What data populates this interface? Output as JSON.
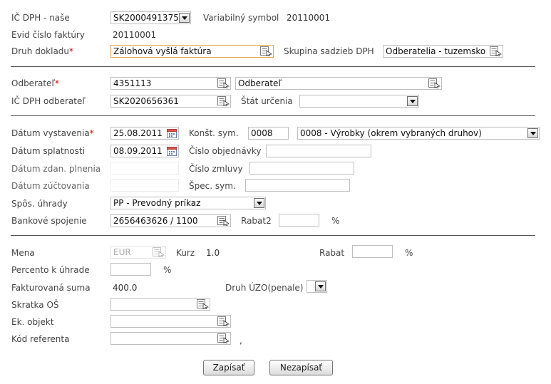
{
  "row1": {
    "ic_dph_nase_label": "IČ DPH - naše",
    "ic_dph_nase_value": "SK2000491375",
    "variabilny_symbol_label": "Variabilný symbol",
    "variabilny_symbol_value": "20110001"
  },
  "row2": {
    "evid_cislo_label": "Evid číslo faktúry",
    "evid_cislo_value": "20110001"
  },
  "row3": {
    "druh_dokladu_label": "Druh dokladu",
    "required_mark": "*",
    "druh_dokladu_value": "Zálohová vyšlá faktúra",
    "skupina_label": "Skupina sadzieb DPH",
    "skupina_value": "Odberatelia - tuzemsko"
  },
  "customer": {
    "odberatel_label": "Odberateľ",
    "required_mark": "*",
    "odberatel_code": "4351113",
    "odberatel_name": "Odberateľ",
    "ic_dph_odberatel_label": "IČ DPH odberateľ",
    "ic_dph_odberatel_value": "SK2020656361",
    "stat_urcenia_label": "Štát určenia",
    "stat_urcenia_value": ""
  },
  "dates": {
    "datum_vystavenia_label": "Dátum vystavenia",
    "required_mark": "*",
    "datum_vystavenia_value": "25.08.2011",
    "konst_sym_label": "Konšt. sym.",
    "konst_sym_code": "0008",
    "konst_sym_desc": "0008 - Výrobky (okrem vybraných druhov)",
    "datum_splatnosti_label": "Dátum splatnosti",
    "datum_splatnosti_value": "08.09.2011",
    "cislo_objednavky_label": "Číslo objednávky",
    "cislo_objednavky_value": "",
    "datum_zdan_label": "Dátum zdan. plnenia",
    "datum_zdan_value": "",
    "cislo_zmluvy_label": "Číslo zmluvy",
    "cislo_zmluvy_value": "",
    "datum_zuct_label": "Dátum zúčtovania",
    "datum_zuct_value": "",
    "spec_sym_label": "Špec. sym.",
    "spec_sym_value": "",
    "sposob_uhrady_label": "Spôs. úhrady",
    "sposob_uhrady_value": "PP - Prevodný príkaz",
    "bankove_spojenie_label": "Bankové spojenie",
    "bankove_spojenie_value": "2656463626 / 1100",
    "rabat2_label": "Rabat2",
    "rabat2_value": "",
    "percent_sign": "%"
  },
  "finance": {
    "mena_label": "Mena",
    "mena_value": "EUR",
    "kurz_label": "Kurz",
    "kurz_value": "1.0",
    "rabat_label": "Rabat",
    "rabat_value": "",
    "percent_sign": "%",
    "percento_label": "Percento k úhrade",
    "percento_value": "",
    "fakturovana_label": "Fakturovaná suma",
    "fakturovana_value": "400.0",
    "druh_uzo_label": "Druh ÚZO(penale)",
    "druh_uzo_value": "",
    "skratka_os_label": "Skratka OŠ",
    "skratka_os_value": "",
    "ek_objekt_label": "Ek. objekt",
    "ek_objekt_value": "",
    "kod_referenta_label": "Kód referenta",
    "kod_referenta_value": "",
    "trailing_comma": ","
  },
  "actions": {
    "save_label": "Zapísať",
    "cancel_label": "Nezapísať"
  }
}
